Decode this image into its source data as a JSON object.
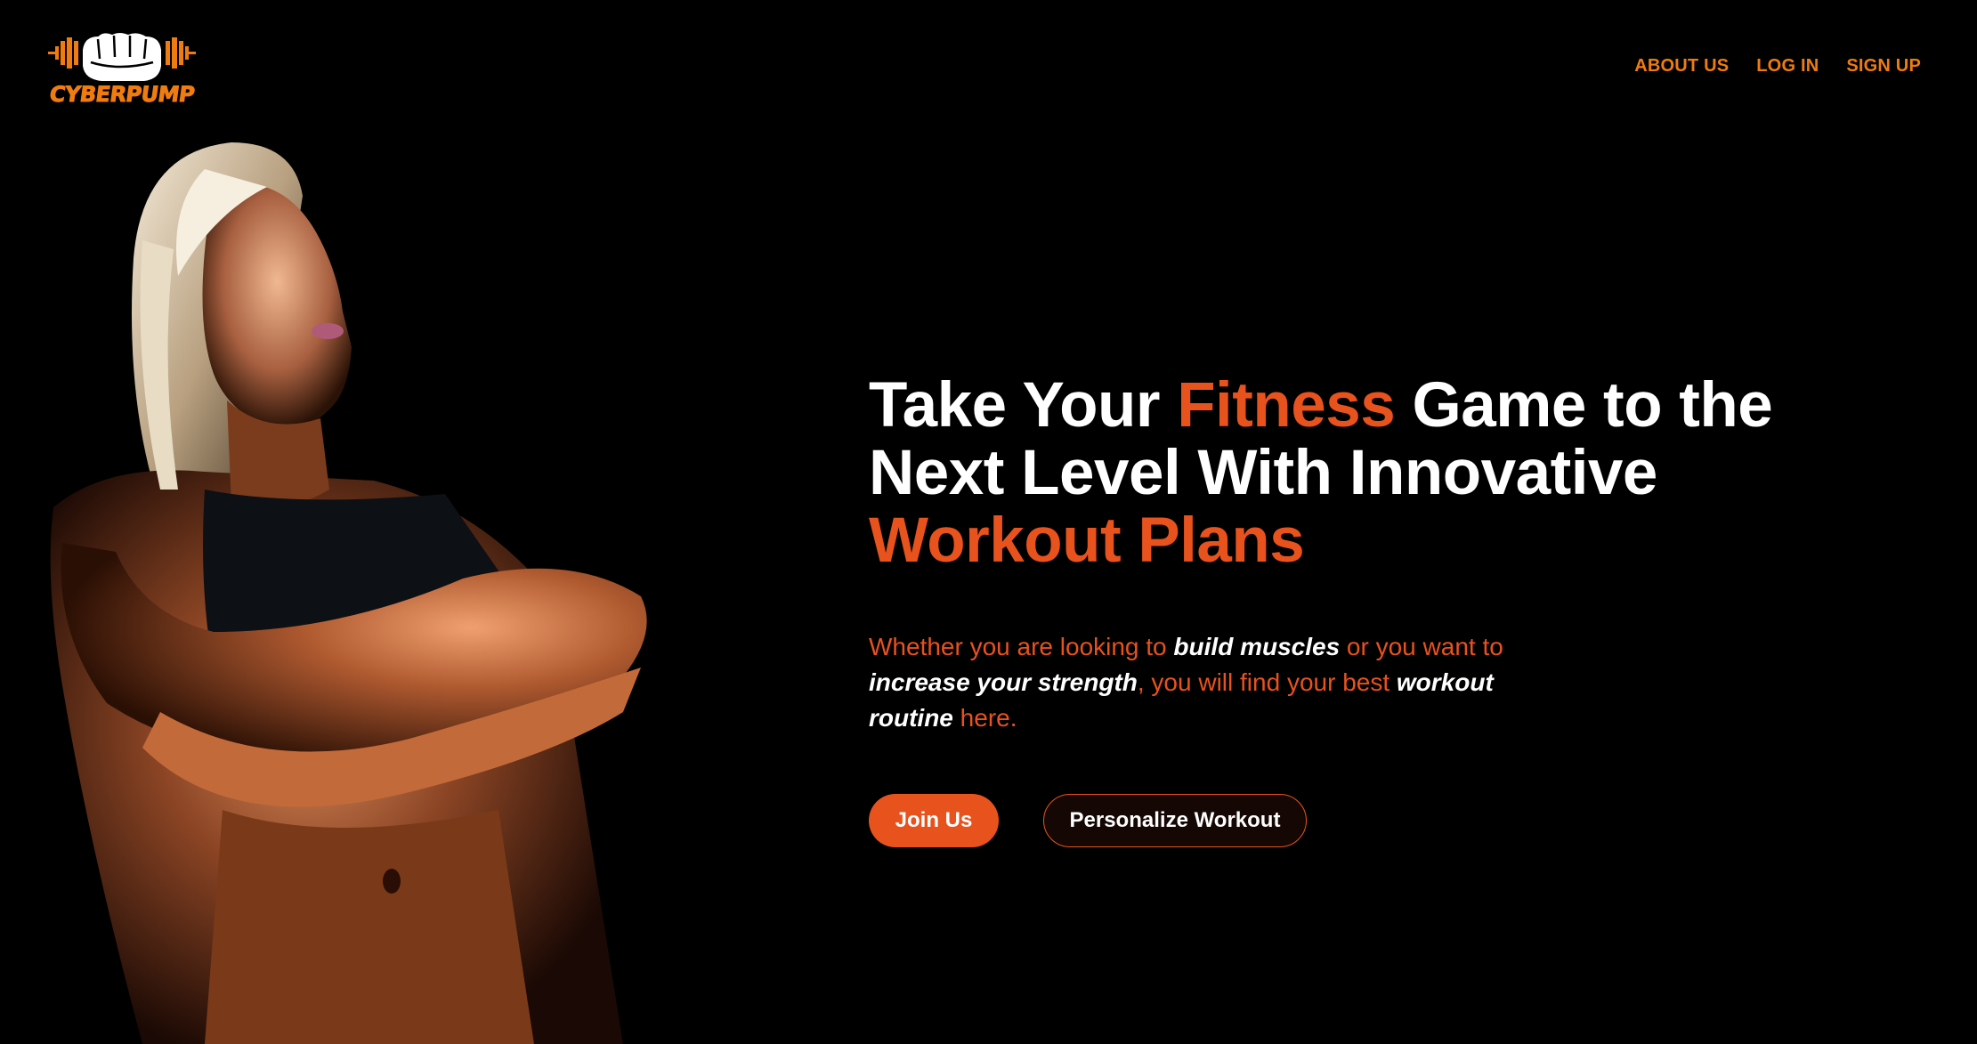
{
  "brand": {
    "name": "CYBERPUMP",
    "accent_color": "#f07c10",
    "logo_icon": "fist-with-dumbbell-icon"
  },
  "nav": {
    "items": [
      {
        "label": "ABOUT US"
      },
      {
        "label": "LOG IN"
      },
      {
        "label": "SIGN UP"
      }
    ]
  },
  "hero": {
    "image_subject": "athletic-woman-arms-crossed",
    "headline": {
      "part1": "Take Your ",
      "part2": "Fitness",
      "part3": " Game to the Next Level With Innovative ",
      "part4": "Workout Plans"
    },
    "subtext": {
      "t1": "Whether you are looking to ",
      "b1": "build muscles",
      "t2": " or you want to ",
      "b2": "increase your strength",
      "t3": ", you will find your best ",
      "b3": "workout routine",
      "t4": " here."
    },
    "primary_button": "Join Us",
    "secondary_button": "Personalize Workout"
  },
  "colors": {
    "background": "#000000",
    "accent": "#e8521d",
    "nav": "#f07c10",
    "text": "#ffffff"
  }
}
